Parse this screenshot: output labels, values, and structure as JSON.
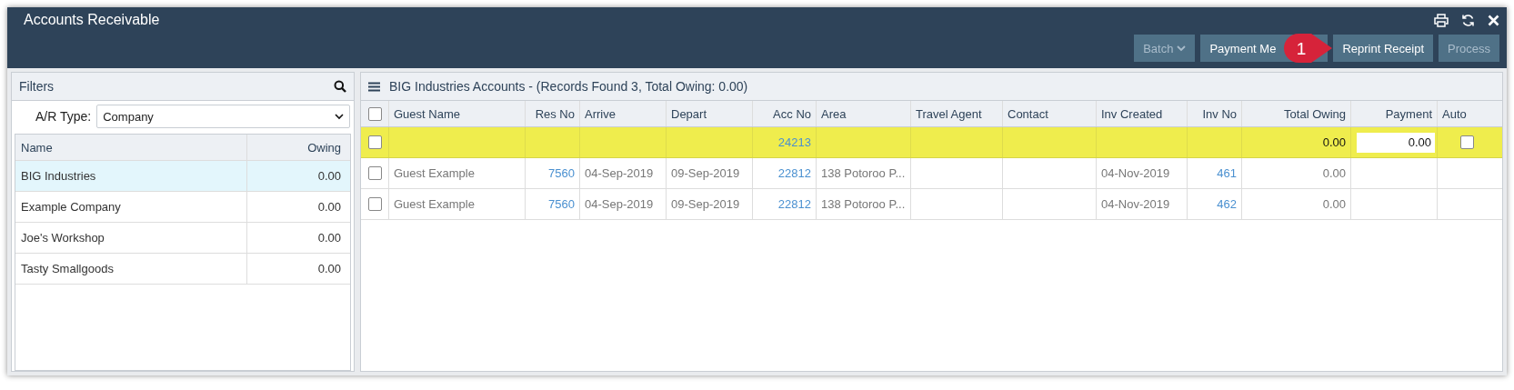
{
  "window": {
    "title": "Accounts Receivable"
  },
  "toolbar_buttons": [
    {
      "label": "Batch",
      "disabled": true,
      "dropdown": true
    },
    {
      "label": "Payment Me",
      "disabled": false,
      "dropdown": false
    },
    {
      "label": "Reprint Receipt",
      "disabled": false,
      "dropdown": false,
      "callout": "1"
    },
    {
      "label": "Process",
      "disabled": true,
      "dropdown": false
    }
  ],
  "filters": {
    "title": "Filters",
    "ar_type_label": "A/R Type:",
    "ar_type_value": "Company",
    "columns": [
      "Name",
      "Owing"
    ],
    "items": [
      {
        "name": "BIG Industries",
        "owing": "0.00",
        "selected": true
      },
      {
        "name": "Example Company",
        "owing": "0.00",
        "selected": false
      },
      {
        "name": "Joe's Workshop",
        "owing": "0.00",
        "selected": false
      },
      {
        "name": "Tasty Smallgoods",
        "owing": "0.00",
        "selected": false
      }
    ]
  },
  "accounts": {
    "title": "BIG Industries Accounts - (Records Found 3, Total Owing: 0.00)",
    "columns": [
      "Guest Name",
      "Res No",
      "Arrive",
      "Depart",
      "Acc No",
      "Area",
      "Travel Agent",
      "Contact",
      "Inv Created",
      "Inv No",
      "Total Owing",
      "Payment",
      "Auto"
    ],
    "header_checked": false,
    "rows": [
      {
        "highlighted": true,
        "checked": false,
        "guest_name": "",
        "res_no": "",
        "arrive": "",
        "depart": "",
        "acc_no": "24213",
        "area": "",
        "travel_agent": "",
        "contact": "",
        "inv_created": "",
        "inv_no": "",
        "total_owing": "0.00",
        "payment": "0.00",
        "auto": false
      },
      {
        "highlighted": false,
        "checked": false,
        "guest_name": "Guest Example",
        "res_no": "7560",
        "arrive": "04-Sep-2019",
        "depart": "09-Sep-2019",
        "acc_no": "22812",
        "area": "138 Potoroo P...",
        "travel_agent": "",
        "contact": "",
        "inv_created": "04-Nov-2019",
        "inv_no": "461",
        "total_owing": "0.00"
      },
      {
        "highlighted": false,
        "checked": false,
        "guest_name": "Guest Example",
        "res_no": "7560",
        "arrive": "04-Sep-2019",
        "depart": "09-Sep-2019",
        "acc_no": "22812",
        "area": "138 Potoroo P...",
        "travel_agent": "",
        "contact": "",
        "inv_created": "04-Nov-2019",
        "inv_no": "462",
        "total_owing": "0.00"
      }
    ]
  }
}
